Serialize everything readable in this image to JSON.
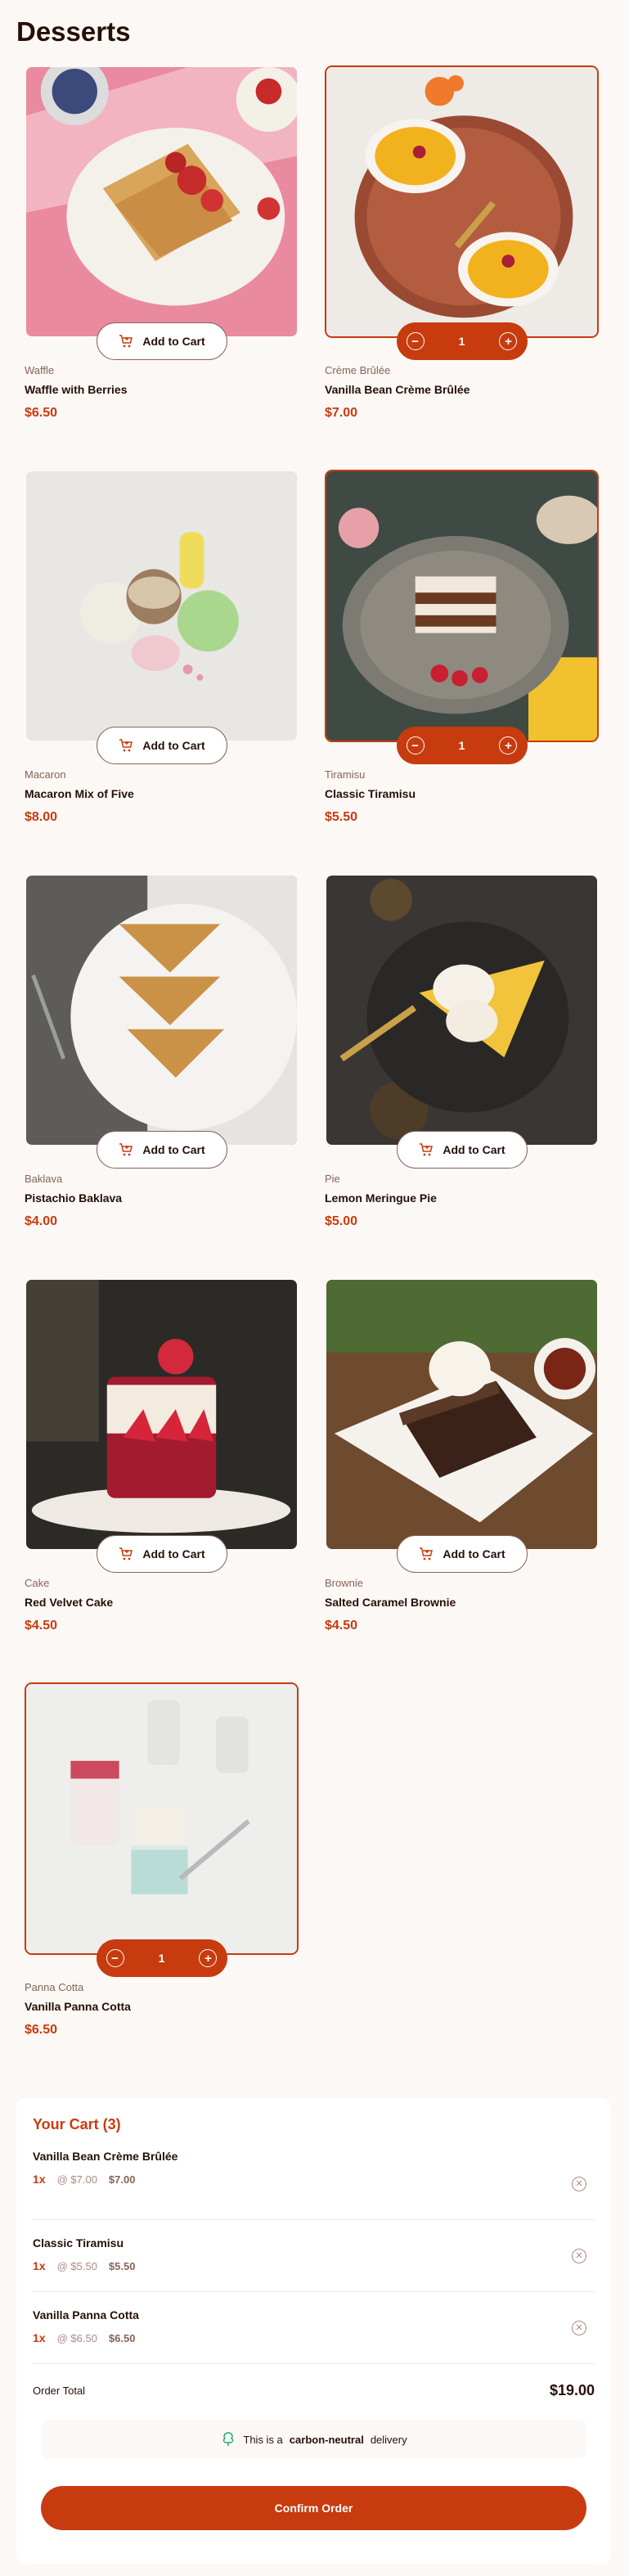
{
  "page": {
    "title": "Desserts"
  },
  "products": [
    {
      "category": "Waffle",
      "name": "Waffle with Berries",
      "price": "$6.50",
      "in_cart": false,
      "qty": "",
      "add_label": "Add to Cart"
    },
    {
      "category": "Crème Brûlée",
      "name": "Vanilla Bean Crème Brûlée",
      "price": "$7.00",
      "in_cart": true,
      "qty": "1",
      "add_label": "Add to Cart"
    },
    {
      "category": "Macaron",
      "name": "Macaron Mix of Five",
      "price": "$8.00",
      "in_cart": false,
      "qty": "",
      "add_label": "Add to Cart"
    },
    {
      "category": "Tiramisu",
      "name": "Classic Tiramisu",
      "price": "$5.50",
      "in_cart": true,
      "qty": "1",
      "add_label": "Add to Cart"
    },
    {
      "category": "Baklava",
      "name": "Pistachio Baklava",
      "price": "$4.00",
      "in_cart": false,
      "qty": "",
      "add_label": "Add to Cart"
    },
    {
      "category": "Pie",
      "name": "Lemon Meringue Pie",
      "price": "$5.00",
      "in_cart": false,
      "qty": "",
      "add_label": "Add to Cart"
    },
    {
      "category": "Cake",
      "name": "Red Velvet Cake",
      "price": "$4.50",
      "in_cart": false,
      "qty": "",
      "add_label": "Add to Cart"
    },
    {
      "category": "Brownie",
      "name": "Salted Caramel Brownie",
      "price": "$4.50",
      "in_cart": false,
      "qty": "",
      "add_label": "Add to Cart"
    },
    {
      "category": "Panna Cotta",
      "name": "Vanilla Panna Cotta",
      "price": "$6.50",
      "in_cart": true,
      "qty": "1",
      "add_label": "Add to Cart"
    }
  ],
  "cart": {
    "title": "Your Cart (3)",
    "items": [
      {
        "name": "Vanilla Bean Crème Brûlée",
        "qty": "1x",
        "unit": "@ $7.00",
        "total": "$7.00"
      },
      {
        "name": "Classic Tiramisu",
        "qty": "1x",
        "unit": "@ $5.50",
        "total": "$5.50"
      },
      {
        "name": "Vanilla Panna Cotta",
        "qty": "1x",
        "unit": "@ $6.50",
        "total": "$6.50"
      }
    ],
    "order_total_label": "Order Total",
    "order_total": "$19.00",
    "carbon_prefix": "This is a",
    "carbon_bold": "carbon-neutral",
    "carbon_suffix": "delivery",
    "confirm_label": "Confirm Order"
  },
  "colors": {
    "accent": "#c73b0f",
    "rose900": "#260f08",
    "background": "#fcf8f5"
  },
  "icons": [
    "add-to-cart-icon",
    "decrement-icon",
    "increment-icon",
    "remove-item-icon",
    "carbon-neutral-tree-icon"
  ]
}
